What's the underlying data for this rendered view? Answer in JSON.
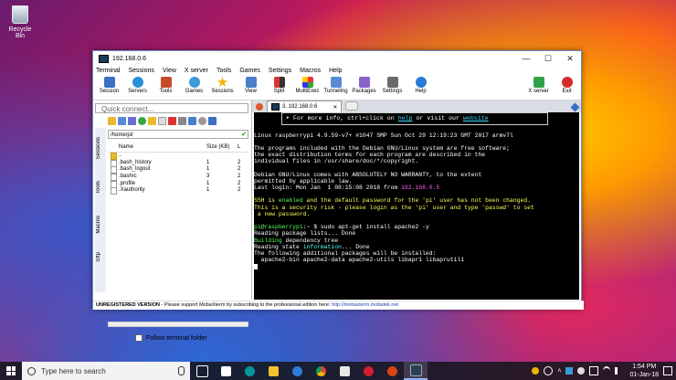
{
  "desktop": {
    "recycle_bin_label": "Recycle Bin"
  },
  "window": {
    "title": "192.168.0.6",
    "menu": [
      "Terminal",
      "Sessions",
      "View",
      "X server",
      "Tools",
      "Games",
      "Settings",
      "Macros",
      "Help"
    ],
    "toolbar": [
      "Session",
      "Servers",
      "Tools",
      "Games",
      "Sessions",
      "View",
      "Split",
      "MultiExec",
      "Tunneling",
      "Packages",
      "Settings",
      "Help"
    ],
    "toolbar_right": [
      "X server",
      "Exit"
    ]
  },
  "sidebar": {
    "quick_connect_placeholder": "Quick connect...",
    "path": "/home/pi/",
    "vertical_tabs": [
      "Sessions",
      "Tools",
      "Macros",
      "Sftp"
    ],
    "columns": {
      "name": "Name",
      "size": "Size (KB)",
      "last": "L"
    },
    "files": [
      {
        "name": "..",
        "size": "",
        "last": ""
      },
      {
        "name": ".bash_history",
        "size": "1",
        "last": "2"
      },
      {
        "name": ".bash_logout",
        "size": "1",
        "last": "2"
      },
      {
        "name": ".bashrc",
        "size": "3",
        "last": "2"
      },
      {
        "name": ".profile",
        "size": "1",
        "last": "2"
      },
      {
        "name": ".Xauthority",
        "size": "1",
        "last": "2"
      }
    ],
    "follow_label": "Follow terminal folder"
  },
  "tabs": {
    "active_label": "3. 192.168.0.6"
  },
  "terminal": {
    "banner": {
      "pre": "➤ For more info, ctrl+click on ",
      "link1": "help",
      "mid": " or visit our ",
      "link2": "website"
    },
    "lines": [
      "",
      "",
      "",
      "Linux raspberrypi 4.9.59-v7+ #1047 SMP Sun Oct 29 12:19:23 GMT 2017 armv7l",
      "",
      "The programs included with the Debian GNU/Linux system are free software;",
      "the exact distribution terms for each program are described in the",
      "individual files in /usr/share/doc/*/copyright.",
      "",
      "Debian GNU/Linux comes with ABSOLUTELY NO WARRANTY, to the extent",
      "permitted by applicable law."
    ],
    "last_login": {
      "text": "Last login: Mon Jan  1 08:15:08 2018 from ",
      "ip": "192.168.0.5"
    },
    "ssh_line": {
      "pre": "SSH is ",
      "enabled": "enabled",
      "post": " and the default password for the 'pi' user has not been changed."
    },
    "security_lines": [
      "This is a security risk - please login as the 'pi' user and type 'passwd' to set",
      " a new password."
    ],
    "prompt": {
      "user": "pi@raspberrypi",
      "sep": ":~ $ ",
      "command": "sudo apt-get install apache2 -y"
    },
    "output": [
      "Reading package lists... Done"
    ],
    "building": {
      "word": "Building",
      "rest": " dependency tree"
    },
    "reading_state": {
      "pre": "Reading state ",
      "word": "information",
      "post": "... Done"
    },
    "output2": [
      "The following additional packages will be installed:",
      "  apache2-bin apache2-data apache2-utils libapr1 libaprutil1"
    ]
  },
  "statusbar": {
    "label": "UNREGISTERED VERSION",
    "text": "  -  Please support MobaXterm by subscribing to the professional edition here:  ",
    "link": "http://mobaxterm.mobatek.net"
  },
  "taskbar": {
    "search_placeholder": "Type here to search",
    "time": "1:54 PM",
    "date": "01-Jan-18"
  },
  "colors": {
    "terminal_bg": "#000000",
    "taskbar_bg": "#16161e",
    "link": "#3fd9ff"
  }
}
